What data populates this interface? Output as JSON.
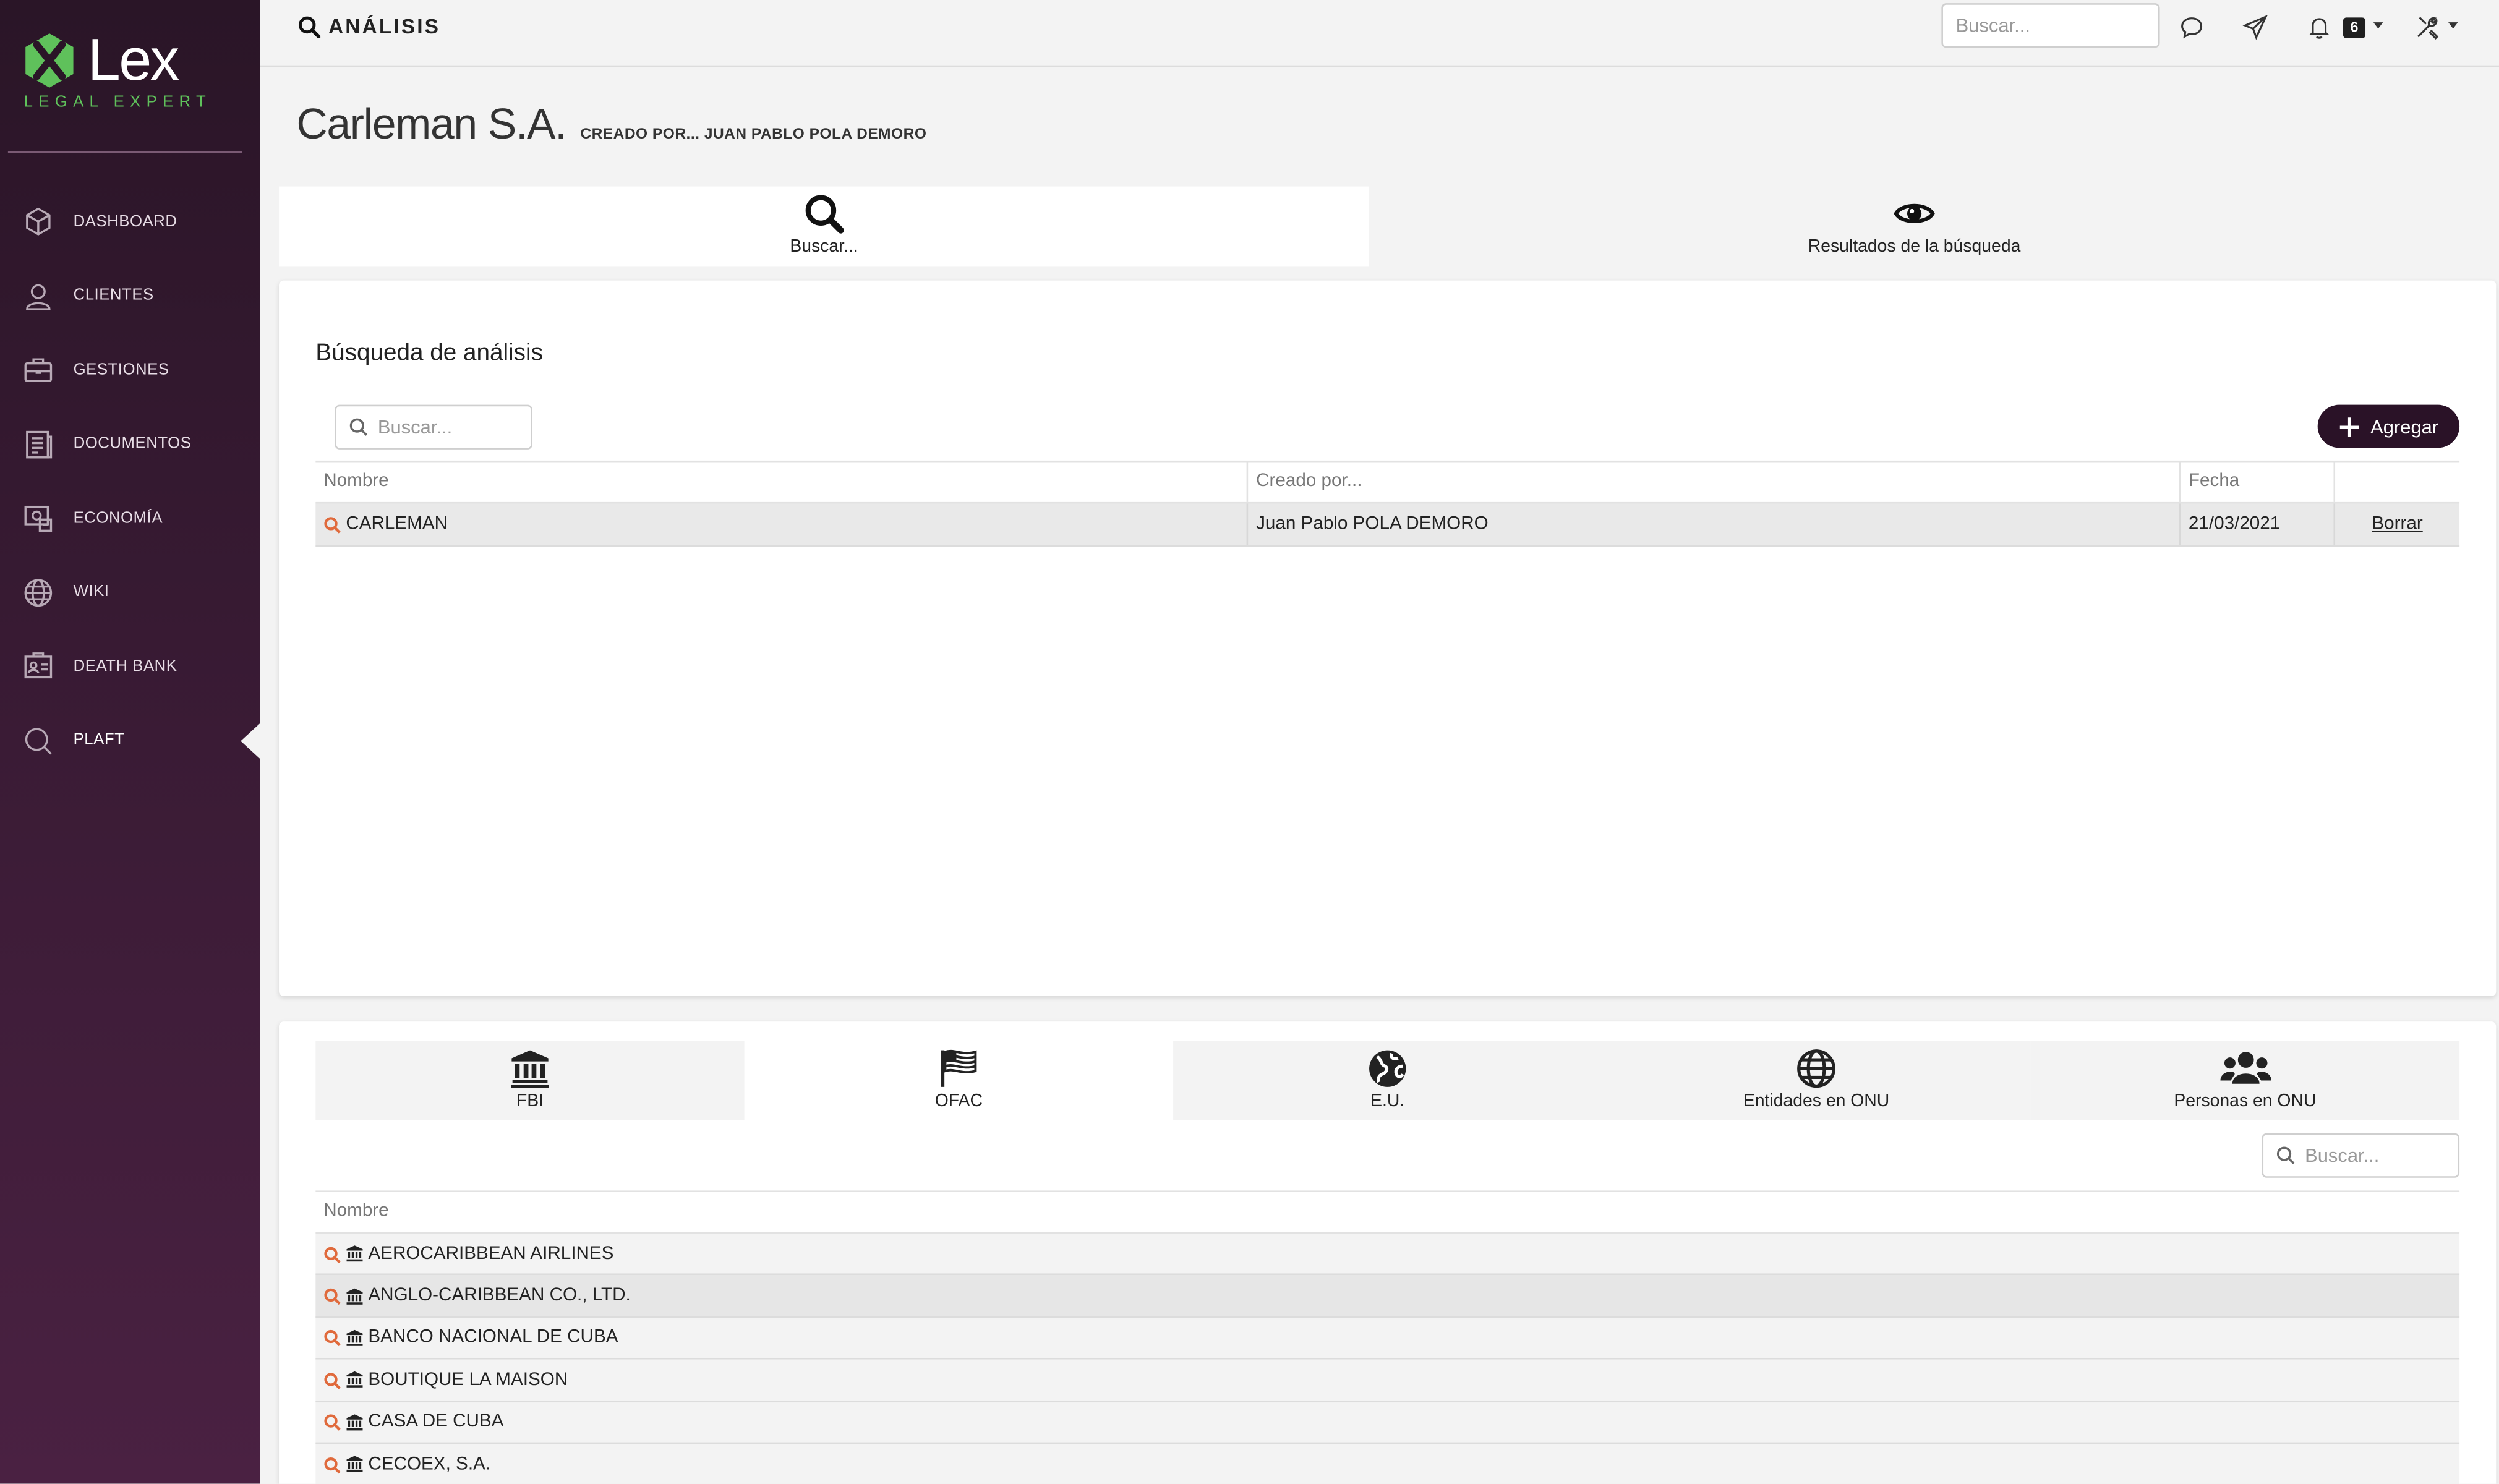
{
  "brand": {
    "name": "Lex",
    "tagline": "LEGAL EXPERT",
    "accent": "#5fc15b",
    "sidebar_bg": "#3a1b35"
  },
  "sidebar": {
    "items": [
      {
        "label": "DASHBOARD",
        "icon": "cube-icon"
      },
      {
        "label": "CLIENTES",
        "icon": "user-icon"
      },
      {
        "label": "GESTIONES",
        "icon": "briefcase-icon"
      },
      {
        "label": "DOCUMENTOS",
        "icon": "document-icon"
      },
      {
        "label": "ECONOMÍA",
        "icon": "money-icon"
      },
      {
        "label": "WIKI",
        "icon": "globe-icon"
      },
      {
        "label": "DEATH BANK",
        "icon": "id-card-icon"
      },
      {
        "label": "PLAFT",
        "icon": "search-icon",
        "active": true
      }
    ]
  },
  "topbar": {
    "title": "ANÁLISIS",
    "search_placeholder": "Buscar...",
    "notification_count": "6"
  },
  "page": {
    "title": "Carleman S.A.",
    "subtitle": "CREADO POR... JUAN PABLO POLA DEMORO"
  },
  "tabs": [
    {
      "label": "Buscar...",
      "icon": "search-icon",
      "active": true
    },
    {
      "label": "Resultados de la búsqueda",
      "icon": "eye-icon",
      "active": false
    }
  ],
  "analysis": {
    "title": "Búsqueda de análisis",
    "search_placeholder": "Buscar...",
    "add_label": "Agregar",
    "columns": [
      "Nombre",
      "Creado por...",
      "Fecha",
      ""
    ],
    "rows": [
      {
        "name": "CARLEMAN",
        "created_by": "Juan Pablo POLA DEMORO",
        "date": "21/03/2021",
        "action": "Borrar"
      }
    ]
  },
  "sources": {
    "tabs": [
      {
        "label": "FBI",
        "icon": "bank-icon"
      },
      {
        "label": "OFAC",
        "icon": "flag-icon",
        "active": true
      },
      {
        "label": "E.U.",
        "icon": "earth-icon"
      },
      {
        "label": "Entidades en ONU",
        "icon": "globe-icon"
      },
      {
        "label": "Personas en ONU",
        "icon": "users-icon"
      }
    ],
    "search_placeholder": "Buscar...",
    "column": "Nombre",
    "items": [
      "AEROCARIBBEAN AIRLINES",
      "ANGLO-CARIBBEAN CO., LTD.",
      "BANCO NACIONAL DE CUBA",
      "BOUTIQUE LA MAISON",
      "CASA DE CUBA",
      "CECOEX, S.A."
    ]
  }
}
